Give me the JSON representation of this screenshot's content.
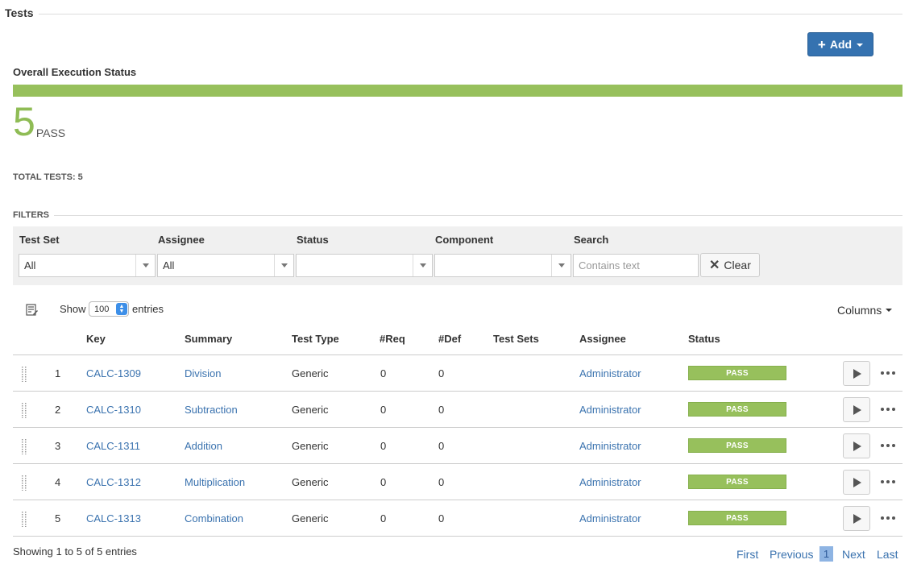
{
  "section": {
    "title": "Tests"
  },
  "add_button": {
    "label": "Add",
    "icon": "plus-icon"
  },
  "execution_status": {
    "title": "Overall Execution Status",
    "pass_fraction": 1.0,
    "count": "5",
    "count_label": "PASS",
    "total_label": "TOTAL TESTS: 5"
  },
  "filters": {
    "title": "FILTERS",
    "test_set": {
      "label": "Test Set",
      "value": "All"
    },
    "assignee": {
      "label": "Assignee",
      "value": "All"
    },
    "status": {
      "label": "Status",
      "value": ""
    },
    "component": {
      "label": "Component",
      "value": ""
    },
    "search": {
      "label": "Search",
      "placeholder": "Contains text",
      "value": ""
    },
    "clear_label": "Clear"
  },
  "table_controls": {
    "show_label": "Show",
    "entries_value": "100",
    "entries_label": "entries",
    "columns_label": "Columns"
  },
  "table": {
    "headers": {
      "key": "Key",
      "summary": "Summary",
      "test_type": "Test Type",
      "req": "#Req",
      "def": "#Def",
      "test_sets": "Test Sets",
      "assignee": "Assignee",
      "status": "Status"
    },
    "rows": [
      {
        "index": "1",
        "key": "CALC-1309",
        "summary": "Division",
        "test_type": "Generic",
        "req": "0",
        "def": "0",
        "test_sets": "",
        "assignee": "Administrator",
        "status": "PASS"
      },
      {
        "index": "2",
        "key": "CALC-1310",
        "summary": "Subtraction",
        "test_type": "Generic",
        "req": "0",
        "def": "0",
        "test_sets": "",
        "assignee": "Administrator",
        "status": "PASS"
      },
      {
        "index": "3",
        "key": "CALC-1311",
        "summary": "Addition",
        "test_type": "Generic",
        "req": "0",
        "def": "0",
        "test_sets": "",
        "assignee": "Administrator",
        "status": "PASS"
      },
      {
        "index": "4",
        "key": "CALC-1312",
        "summary": "Multiplication",
        "test_type": "Generic",
        "req": "0",
        "def": "0",
        "test_sets": "",
        "assignee": "Administrator",
        "status": "PASS"
      },
      {
        "index": "5",
        "key": "CALC-1313",
        "summary": "Combination",
        "test_type": "Generic",
        "req": "0",
        "def": "0",
        "test_sets": "",
        "assignee": "Administrator",
        "status": "PASS"
      }
    ]
  },
  "footer": {
    "showing": "Showing 1 to 5 of 5 entries",
    "pagination": {
      "first": "First",
      "previous": "Previous",
      "current": "1",
      "next": "Next",
      "last": "Last"
    }
  },
  "colors": {
    "pass_green": "#97c05c",
    "link_blue": "#3b73af",
    "primary_button": "#3572b0"
  }
}
